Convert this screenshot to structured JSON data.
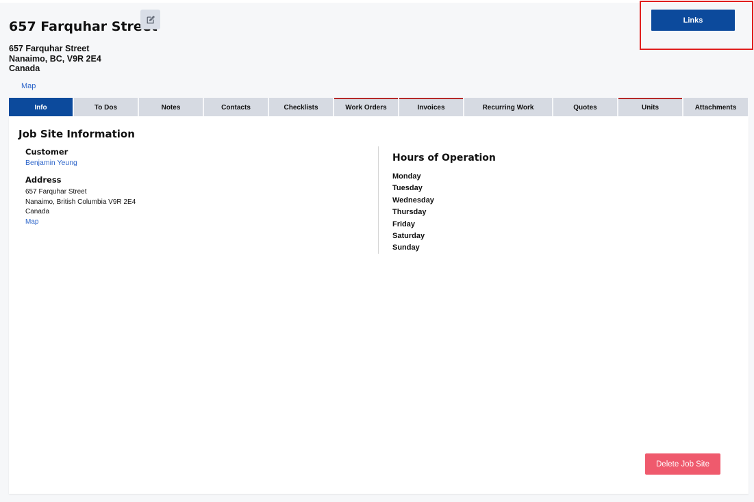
{
  "header": {
    "title": "657 Farquhar Street",
    "edit_icon": "pencil-square-icon",
    "address": {
      "line1": "657 Farquhar Street",
      "line2": "Nanaimo, BC, V9R 2E4",
      "line3": "Canada"
    },
    "map_label": "Map",
    "links_label": "Links"
  },
  "tabs": [
    {
      "label": "Info",
      "active": true
    },
    {
      "label": "To Dos"
    },
    {
      "label": "Notes"
    },
    {
      "label": "Contacts"
    },
    {
      "label": "Checklists"
    },
    {
      "label": "Work Orders"
    },
    {
      "label": "Invoices"
    },
    {
      "label": "Recurring Work"
    },
    {
      "label": "Quotes"
    },
    {
      "label": "Units"
    },
    {
      "label": "Attachments"
    }
  ],
  "info": {
    "section_title": "Job Site Information",
    "customer_label": "Customer",
    "customer_name": "Benjamin Yeung",
    "address_label": "Address",
    "address_lines": [
      "657 Farquhar Street",
      "Nanaimo, British Columbia V9R 2E4",
      "Canada"
    ],
    "map_label": "Map",
    "hours_title": "Hours of Operation",
    "days": [
      "Monday",
      "Tuesday",
      "Wednesday",
      "Thursday",
      "Friday",
      "Saturday",
      "Sunday"
    ],
    "delete_label": "Delete Job Site"
  },
  "colors": {
    "primary": "#0c4a9c",
    "link": "#2a63c9",
    "danger": "#ef5a6d",
    "highlight": "#e01e1e"
  }
}
